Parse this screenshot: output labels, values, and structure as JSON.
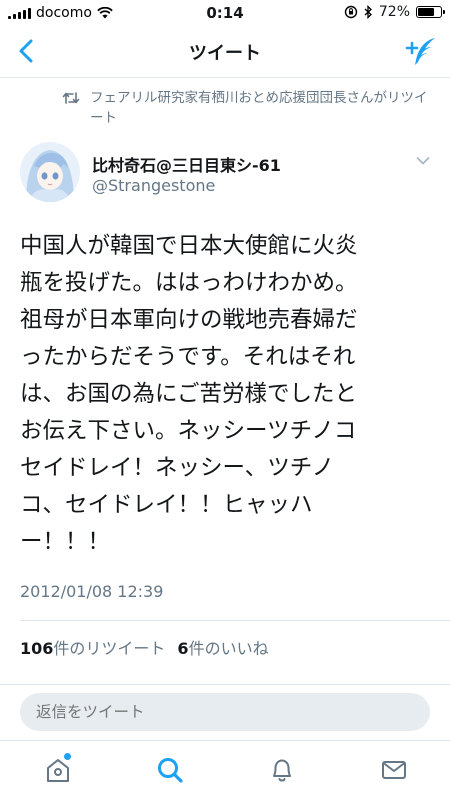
{
  "status_bar": {
    "carrier": "docomo",
    "time": "0:14",
    "battery": "72%",
    "battery_level": 0.72
  },
  "nav": {
    "title": "ツイート"
  },
  "retweet_context": "フェアリル研究家有栖川おとめ応援団団長さんがリツイート",
  "tweet": {
    "author_name": "比村奇石@三日目東シ-61",
    "author_handle": "@Strangestone",
    "text": "中国人が韓国で日本大使館に火炎\n瓶を投げた。ははっわけわかめ。\n祖母が日本軍向けの戦地売春婦だ\nったからだそうです。それはそれ\nは、お国の為にご苦労様でしたと\nお伝え下さい。ネッシーツチノコ\nセイドレイ！ネッシー、ツチノ\nコ、セイドレイ！！ヒャッハ\nー！！！",
    "timestamp": "2012/01/08 12:39"
  },
  "stats": {
    "retweets_count": "106",
    "retweets_label": "件のリツイート",
    "likes_count": "6",
    "likes_label": "件のいいね"
  },
  "reply": {
    "placeholder": "返信をツイート"
  },
  "tabbar": {
    "items": [
      "home-icon",
      "search-icon",
      "notifications-icon",
      "messages-icon"
    ]
  },
  "colors": {
    "accent": "#1da1f2",
    "muted": "#657786",
    "text": "#14171a"
  }
}
